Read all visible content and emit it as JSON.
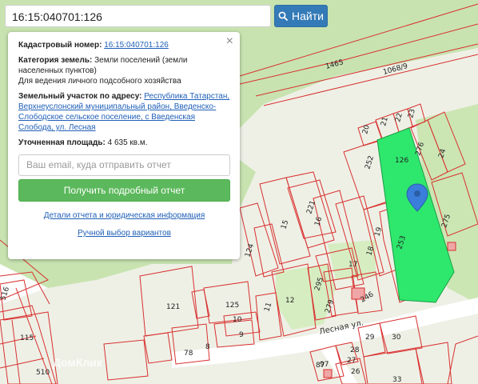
{
  "search": {
    "value": "16:15:040701:126",
    "button_label": "Найти"
  },
  "info": {
    "cadastral_label": "Кадастровый номер:",
    "cadastral_value": "16:15:040701:126",
    "land_category_label": "Категория земель:",
    "land_category_value": "Земли поселений (земли населенных пунктов)",
    "permitted_use": "Для ведения личного подсобного хозяйства",
    "address_label": "Земельный участок по адресу:",
    "address_value": "Республика Татарстан, Верхнеуслонский муниципальный район, Введенско-Слободское сельское поселение, с Введенская Слобода, ул. Лесная",
    "area_label": "Уточненная площадь:",
    "area_value": "4 635 кв.м.",
    "email_placeholder": "Ваш email, куда отправить отчет",
    "report_button": "Получить подробный отчет",
    "details_link": "Детали отчета и юридическая информация",
    "manual_link": "Ручной выбор вариантов",
    "close_symbol": "×"
  },
  "map": {
    "street_name": "Лесная ул.",
    "watermark_brand": "ДомКлик",
    "selected_plot_label": "126",
    "plot_labels": [
      "1465",
      "1068/9",
      "20",
      "21",
      "22",
      "23",
      "276",
      "24",
      "252",
      "275",
      "253",
      "19",
      "18",
      "15",
      "16",
      "221",
      "124",
      "17",
      "12",
      "279",
      "295",
      "246",
      "121",
      "125",
      "10",
      "11",
      "9",
      "78",
      "8",
      "97",
      "115",
      "516",
      "510",
      "87",
      "28",
      "27",
      "26",
      "29",
      "30",
      "33"
    ],
    "colors": {
      "plot_border": "#d9302f",
      "selected_fill": "#2ee86d",
      "background": "#eef0e6",
      "green_area": "#c8e3b0",
      "pin": "#3a7ddb",
      "road": "#ffffff"
    }
  }
}
